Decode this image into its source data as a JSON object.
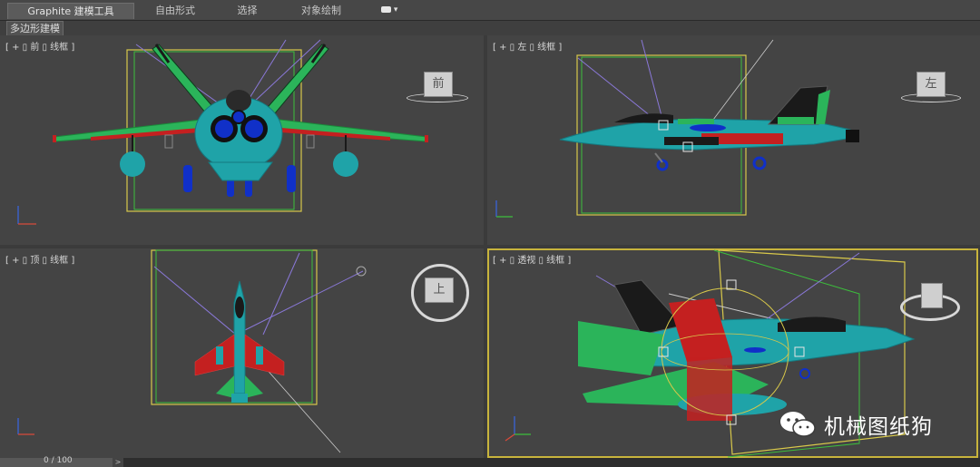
{
  "ribbon": {
    "tabs": [
      {
        "label": "Graphite 建模工具",
        "active": true
      },
      {
        "label": "自由形式"
      },
      {
        "label": "选择"
      },
      {
        "label": "对象绘制"
      }
    ],
    "dropdown": "▾"
  },
  "subtab": {
    "label": "多边形建模"
  },
  "viewports": {
    "front": {
      "label": "[ + ▯ 前 ▯ 线框 ]",
      "cube_label": "前"
    },
    "left": {
      "label": "[ + ▯ 左 ▯ 线框 ]",
      "cube_label": "左"
    },
    "top": {
      "label": "[ + ▯ 顶 ▯ 线框 ]",
      "cube_label": "上"
    },
    "persp": {
      "label": "[ + ▯ 透视 ▯ 线框 ]"
    }
  },
  "timeline": {
    "frame": "0 / 100",
    "prev": "<",
    "next": ">"
  },
  "watermark": {
    "text": "机械图纸狗"
  },
  "colors": {
    "fuselage": "#1fa3a8",
    "wing_green": "#2bb45a",
    "red_parts": "#c42020",
    "dark_parts": "#1a1a1a",
    "blue_parts": "#1030c8",
    "frame_yellow": "#d8c84a",
    "frame_green": "#3cbf3c",
    "active_border": "#c8b43c"
  },
  "icons": [
    "view-cube-icon",
    "axis-gizmo-icon",
    "wechat-icon",
    "light-icon"
  ]
}
